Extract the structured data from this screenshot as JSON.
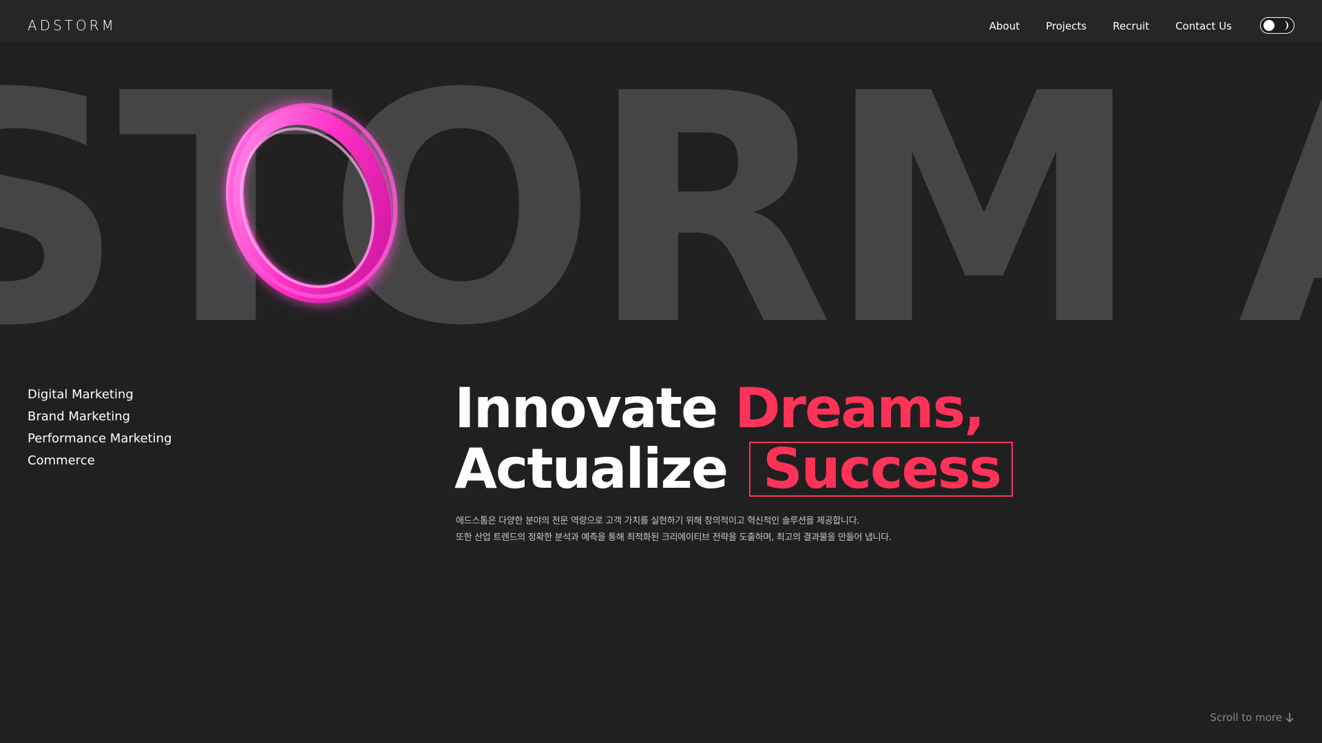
{
  "header": {
    "logo_text": "ADSTORM",
    "nav": [
      {
        "label": "About"
      },
      {
        "label": "Projects"
      },
      {
        "label": "Recruit"
      },
      {
        "label": "Contact Us"
      }
    ],
    "theme_toggle": {
      "state": "light-knob",
      "icon": "moon-icon"
    }
  },
  "hero": {
    "background_word": "STORM ADS",
    "swirl_color": "#ff3cc8"
  },
  "services": [
    "Digital Marketing",
    "Brand Marketing",
    "Performance Marketing",
    "Commerce"
  ],
  "headline": {
    "line1_plain": "Innovate ",
    "line1_accent": "Dreams,",
    "line2_plain": "Actualize",
    "line2_boxed": "Success"
  },
  "description": {
    "line1": "애드스톰은 다양한 분야의 전문 역량으로 고객 가치를 실현하기 위해 창의적이고 혁신적인 솔루션을 제공합니다.",
    "line2": "또한 산업 트렌드의 정확한 분석과 예측을 통해 최적화된 크리에이티브 전략을 도출하며, 최고의 결과물을 만들어 냅니다."
  },
  "scroll_hint": "Scroll to more",
  "colors": {
    "background": "#202020",
    "header": "#262626",
    "accent": "#ff3358",
    "big_text": "#454545"
  }
}
